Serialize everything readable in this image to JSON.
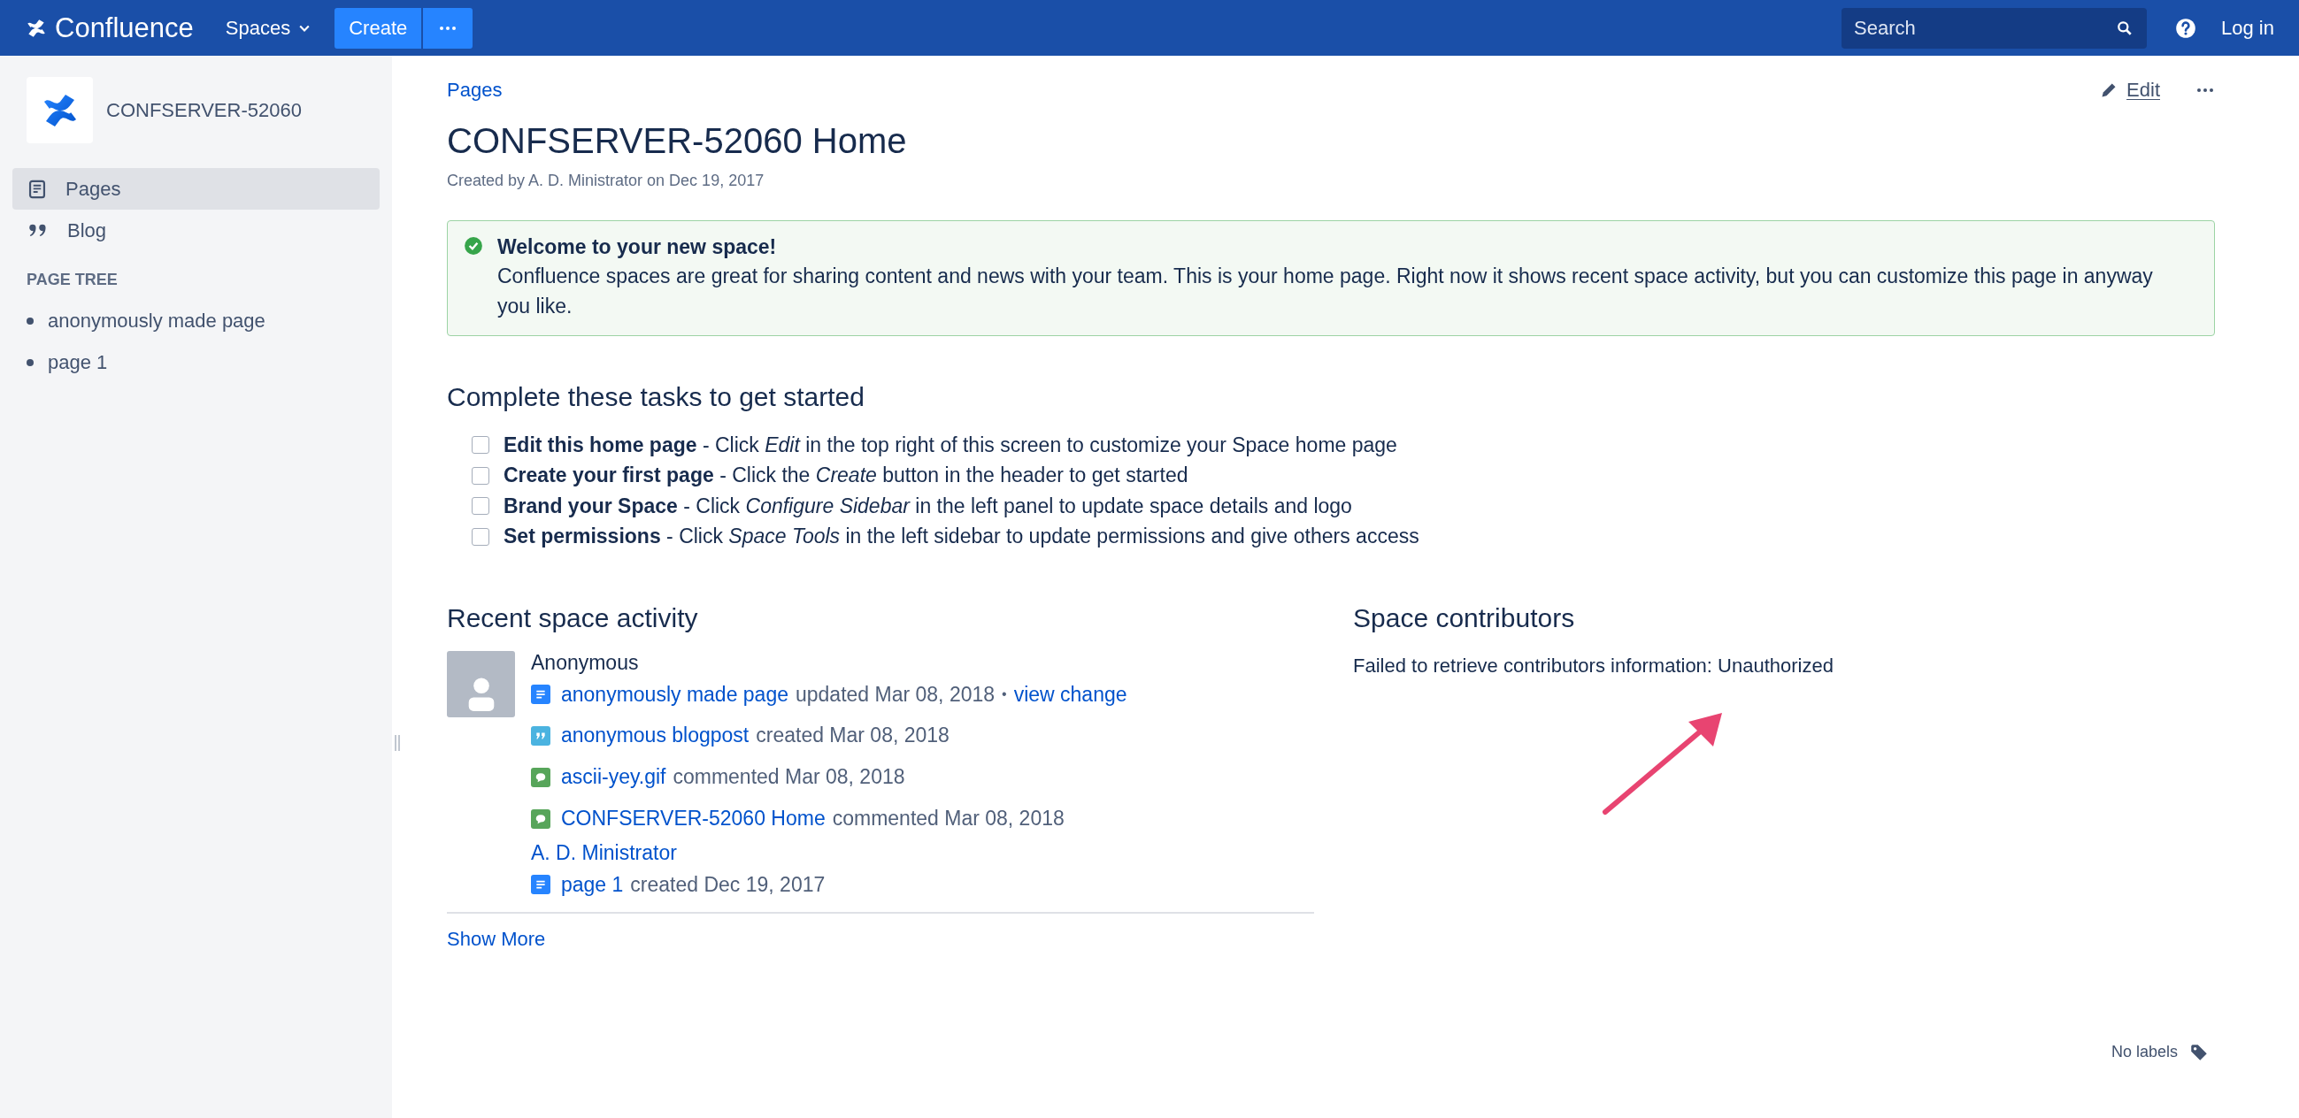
{
  "header": {
    "product": "Confluence",
    "spaces_menu": "Spaces",
    "create_button": "Create",
    "search": {
      "placeholder": "Search"
    },
    "login": "Log in"
  },
  "sidebar": {
    "space_name": "CONFSERVER-52060",
    "nav": [
      {
        "label": "Pages",
        "kind": "pages",
        "selected": true
      },
      {
        "label": "Blog",
        "kind": "blog",
        "selected": false
      }
    ],
    "tree_heading": "PAGE TREE",
    "tree": [
      {
        "label": "anonymously made page"
      },
      {
        "label": "page 1"
      }
    ]
  },
  "page": {
    "breadcrumb": "Pages",
    "edit": "Edit",
    "title": "CONFSERVER-52060 Home",
    "byline": "Created by A. D. Ministrator on Dec 19, 2017",
    "welcome": {
      "title": "Welcome to your new space!",
      "body": "Confluence spaces are great for sharing content and news with your team. This is your home page. Right now it shows recent space activity, but you can customize this page in anyway you like."
    },
    "tasks_heading": "Complete these tasks to get started",
    "tasks": [
      {
        "text": "**Edit this home page** - Click *Edit* in the top right of this screen to customize your Space home page",
        "checked": false
      },
      {
        "text": "**Create your first page** - Click the *Create* button in the header to get started",
        "checked": false
      },
      {
        "text": "**Brand your Space** - Click *Configure Sidebar* in the left panel to update space details and logo",
        "checked": false
      },
      {
        "text": "**Set permissions** - Click *Space Tools* in the left sidebar to update permissions and give others access",
        "checked": false
      }
    ],
    "activity": {
      "heading": "Recent space activity",
      "groups": [
        {
          "author": "Anonymous",
          "linked": false,
          "avatar": true,
          "items": [
            {
              "kind": "page",
              "title": "anonymously made page",
              "action": "updated Mar 08, 2018",
              "separator": "•",
              "link": "view change"
            },
            {
              "kind": "blog",
              "title": "anonymous blogpost",
              "action": "created Mar 08, 2018"
            },
            {
              "kind": "comment",
              "title": "ascii-yey.gif",
              "action": "commented Mar 08, 2018"
            },
            {
              "kind": "comment",
              "title": "CONFSERVER-52060 Home",
              "action": "commented Mar 08, 2018"
            }
          ]
        },
        {
          "author": "A. D. Ministrator",
          "linked": true,
          "avatar": false,
          "items": [
            {
              "kind": "page",
              "title": "page 1",
              "action": "created Dec 19, 2017"
            }
          ]
        }
      ],
      "show_more": "Show More"
    },
    "contributors": {
      "heading": "Space contributors",
      "message": "Failed to retrieve contributors information: Unauthorized"
    },
    "labels": "No labels"
  }
}
